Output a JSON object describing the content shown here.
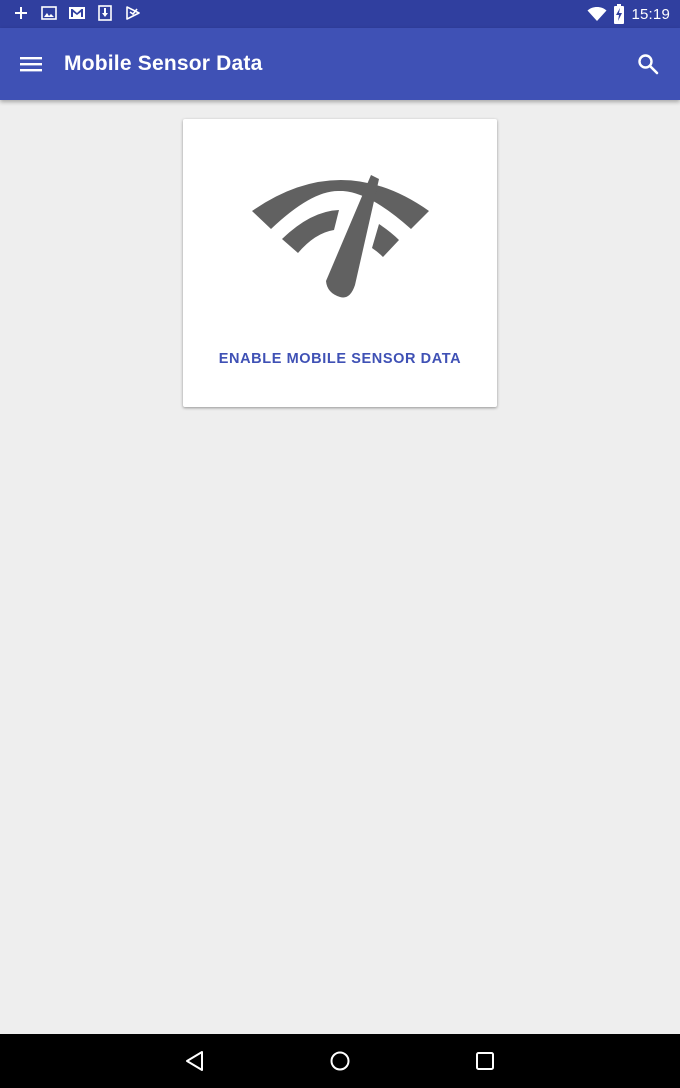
{
  "status_bar": {
    "time": "15:19",
    "left_icons": [
      "add-icon",
      "image-icon",
      "gmail-icon",
      "download-icon",
      "play-store-icon"
    ],
    "right_icons": [
      "wifi-icon",
      "battery-charging-icon"
    ]
  },
  "app_bar": {
    "title": "Mobile Sensor Data",
    "color": "#3f51b5",
    "status_color": "#303f9f"
  },
  "card": {
    "icon": "speedometer-icon",
    "action_label": "ENABLE MOBILE SENSOR DATA",
    "action_color": "#3f51b5"
  },
  "nav_bar": {
    "buttons": [
      "back-icon",
      "home-icon",
      "recents-icon"
    ]
  }
}
